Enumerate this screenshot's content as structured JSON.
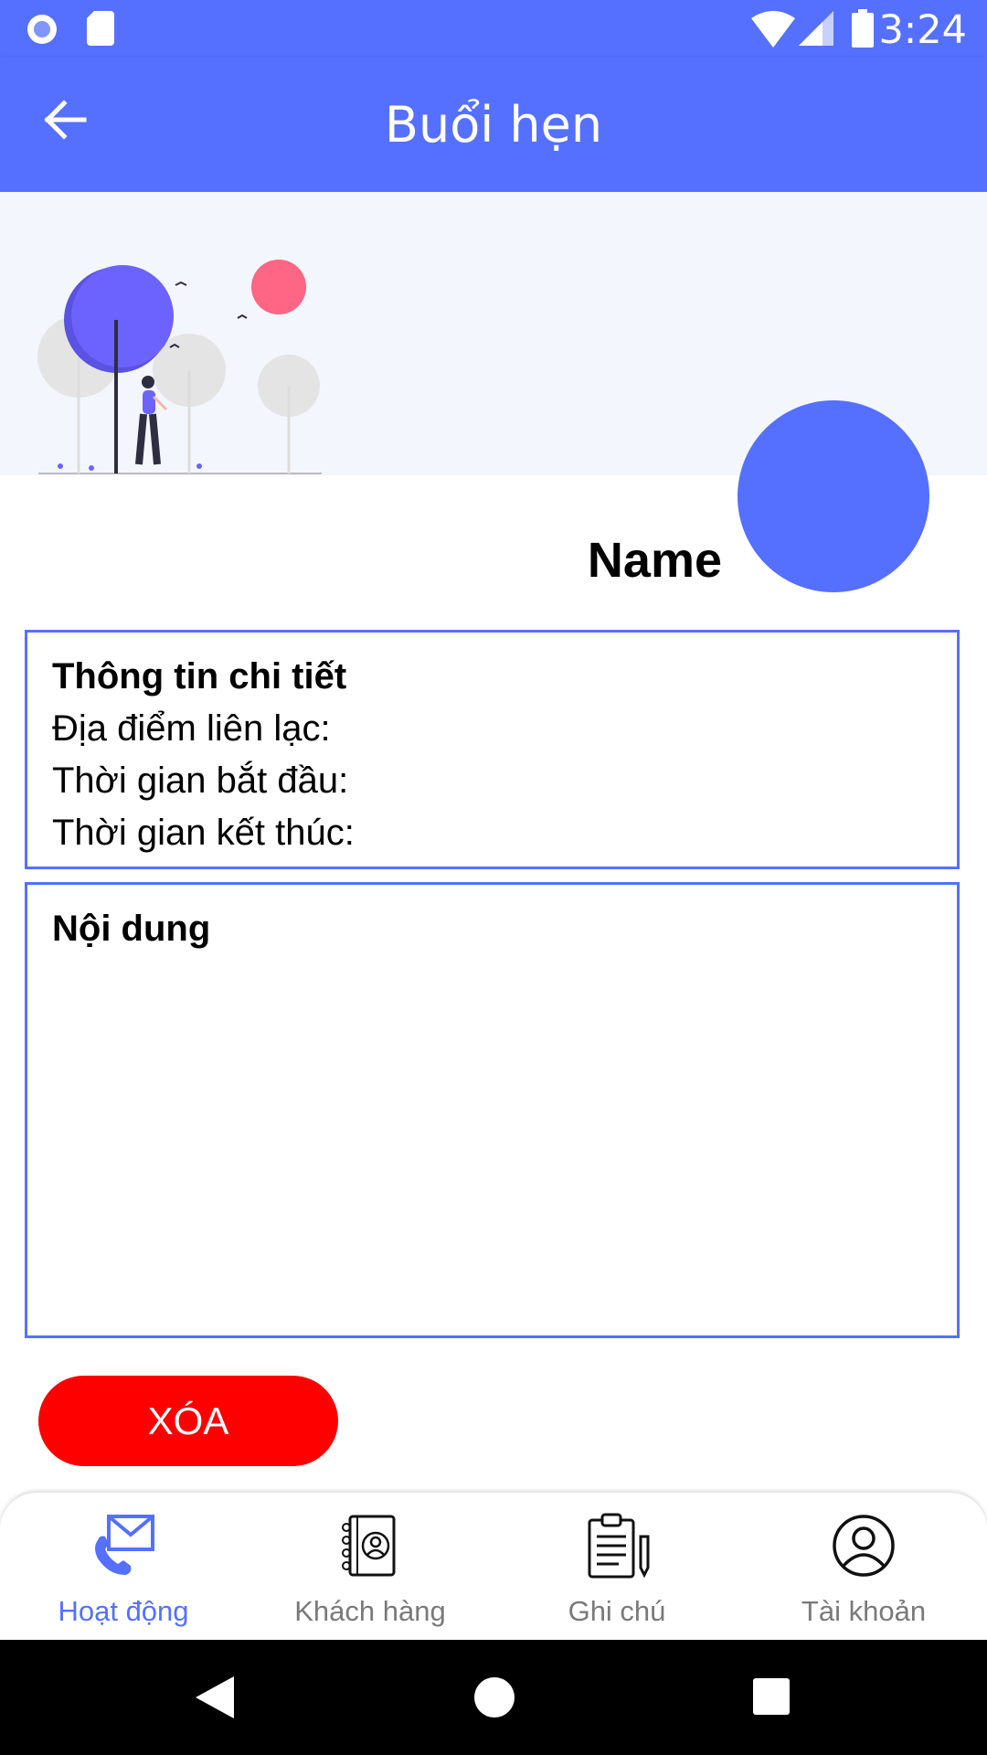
{
  "status_bar": {
    "time": "3:24"
  },
  "app_bar": {
    "title": "Buổi hẹn"
  },
  "profile": {
    "name": "Name"
  },
  "details": {
    "heading": "Thông tin chi tiết",
    "location_label": "Địa điểm liên lạc:",
    "start_label": "Thời gian bắt đầu:",
    "end_label": "Thời gian kết thúc:"
  },
  "content": {
    "heading": "Nội dung"
  },
  "actions": {
    "delete_label": "XÓA"
  },
  "bottom_nav": {
    "items": [
      {
        "label": "Hoạt động",
        "icon": "phone-mail-icon",
        "active": true
      },
      {
        "label": "Khách hàng",
        "icon": "contacts-book-icon",
        "active": false
      },
      {
        "label": "Ghi chú",
        "icon": "clipboard-note-icon",
        "active": false
      },
      {
        "label": "Tài khoản",
        "icon": "account-icon",
        "active": false
      }
    ]
  },
  "colors": {
    "primary": "#5570ff",
    "danger": "#ff0000",
    "hero_bg": "#f4f6fd"
  }
}
